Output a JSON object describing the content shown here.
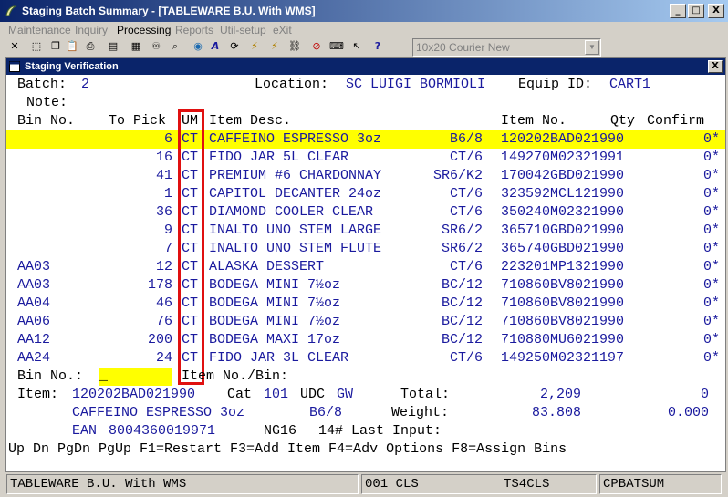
{
  "window": {
    "title": "Staging Batch Summary - [TABLEWARE B.U. With WMS]",
    "minimize": "_",
    "maximize": "□",
    "close": "X"
  },
  "menu": [
    {
      "label": "Maintenance",
      "enabled": false
    },
    {
      "label": "Inquiry",
      "enabled": false
    },
    {
      "label": "Processing",
      "enabled": true
    },
    {
      "label": "Reports",
      "enabled": false
    },
    {
      "label": "Util-setup",
      "enabled": false
    },
    {
      "label": "eXit",
      "enabled": false
    }
  ],
  "toolbar": {
    "font_selector": "10x20 Courier New",
    "icons": [
      "close-x-icon",
      "select-icon",
      "copy-icon",
      "paste-icon",
      "print-icon",
      "notepad-icon",
      "calculator-icon",
      "binoculars-icon",
      "search-icon",
      "globe-icon",
      "font-icon",
      "refresh-icon",
      "lightning-icon",
      "lightning-doc-icon",
      "link-icon",
      "stop-icon",
      "keyboard-icon",
      "help-pointer-icon",
      "help-icon"
    ]
  },
  "child_window": {
    "title": "Staging Verification",
    "close": "X"
  },
  "header": {
    "batch_label": "Batch:",
    "batch_value": "2",
    "location_label": "Location:",
    "location_value": "SC LUIGI BORMIOLI",
    "equip_label": "Equip ID:",
    "equip_value": "CART1",
    "note_label": "Note:"
  },
  "columns": {
    "bin_no": "Bin No.",
    "to_pick": "To Pick",
    "um": "UM",
    "item_desc": "Item Desc.",
    "item_no": "Item No.",
    "qty": "Qty",
    "confirm": "Confirm"
  },
  "rows": [
    {
      "bin": "",
      "to_pick": "6",
      "um": "CT",
      "desc": "CAFFEINO ESPRESSO 3oz",
      "pack": "B6/8",
      "item_no": "120202BAD021990",
      "confirm": "0*",
      "selected": true
    },
    {
      "bin": "",
      "to_pick": "16",
      "um": "CT",
      "desc": "FIDO JAR 5L CLEAR",
      "pack": "CT/6",
      "item_no": "149270M02321991",
      "confirm": "0*",
      "selected": false
    },
    {
      "bin": "",
      "to_pick": "41",
      "um": "CT",
      "desc": "PREMIUM #6 CHARDONNAY",
      "pack": "SR6/K2",
      "item_no": "170042GBD021990",
      "confirm": "0*",
      "selected": false
    },
    {
      "bin": "",
      "to_pick": "1",
      "um": "CT",
      "desc": "CAPITOL DECANTER 24oz",
      "pack": "CT/6",
      "item_no": "323592MCL121990",
      "confirm": "0*",
      "selected": false
    },
    {
      "bin": "",
      "to_pick": "36",
      "um": "CT",
      "desc": "DIAMOND COOLER CLEAR",
      "pack": "CT/6",
      "item_no": "350240M02321990",
      "confirm": "0*",
      "selected": false
    },
    {
      "bin": "",
      "to_pick": "9",
      "um": "CT",
      "desc": "INALTO UNO STEM LARGE",
      "pack": "SR6/2",
      "item_no": "365710GBD021990",
      "confirm": "0*",
      "selected": false
    },
    {
      "bin": "",
      "to_pick": "7",
      "um": "CT",
      "desc": "INALTO UNO STEM FLUTE",
      "pack": "SR6/2",
      "item_no": "365740GBD021990",
      "confirm": "0*",
      "selected": false
    },
    {
      "bin": "AA03",
      "to_pick": "12",
      "um": "CT",
      "desc": "ALASKA DESSERT",
      "pack": "CT/6",
      "item_no": "223201MP1321990",
      "confirm": "0*",
      "selected": false
    },
    {
      "bin": "AA03",
      "to_pick": "178",
      "um": "CT",
      "desc": "BODEGA MINI 7½oz",
      "pack": "BC/12",
      "item_no": "710860BV8021990",
      "confirm": "0*",
      "selected": false
    },
    {
      "bin": "AA04",
      "to_pick": "46",
      "um": "CT",
      "desc": "BODEGA MINI 7½oz",
      "pack": "BC/12",
      "item_no": "710860BV8021990",
      "confirm": "0*",
      "selected": false
    },
    {
      "bin": "AA06",
      "to_pick": "76",
      "um": "CT",
      "desc": "BODEGA MINI 7½oz",
      "pack": "BC/12",
      "item_no": "710860BV8021990",
      "confirm": "0*",
      "selected": false
    },
    {
      "bin": "AA12",
      "to_pick": "200",
      "um": "CT",
      "desc": "BODEGA MAXI 17oz",
      "pack": "BC/12",
      "item_no": "710880MU6021990",
      "confirm": "0*",
      "selected": false
    },
    {
      "bin": "AA24",
      "to_pick": "24",
      "um": "CT",
      "desc": "FIDO JAR 3L CLEAR",
      "pack": "CT/6",
      "item_no": "149250M02321197",
      "confirm": "0*",
      "selected": false
    }
  ],
  "entry": {
    "bin_label": "Bin No.:",
    "bin_value": "_",
    "item_bin_label": "Item No./Bin:"
  },
  "detail": {
    "item_label": "Item:",
    "item_no": "120202BAD021990",
    "cat_label": "Cat",
    "cat_value": "101",
    "udc_label": "UDC",
    "udc_value": "GW",
    "total_label": "Total:",
    "total_value": "2,209",
    "total_right": "0",
    "desc": "CAFFEINO ESPRESSO 3oz",
    "pack": "B6/8",
    "weight_label": "Weight:",
    "weight_value": "83.808",
    "weight_right": "0.000",
    "ean_label": "EAN",
    "ean_value": "8004360019971",
    "ng": "NG16",
    "last_input": "14# Last Input:"
  },
  "keys_line": "Up Dn PgDn PgUp F1=Restart F3=Add Item F4=Adv Options F8=Assign Bins",
  "statusbar": {
    "company": "TABLEWARE B.U. With WMS",
    "site": "001 CLS",
    "server": "TS4CLS",
    "program": "CPBATSUM"
  }
}
